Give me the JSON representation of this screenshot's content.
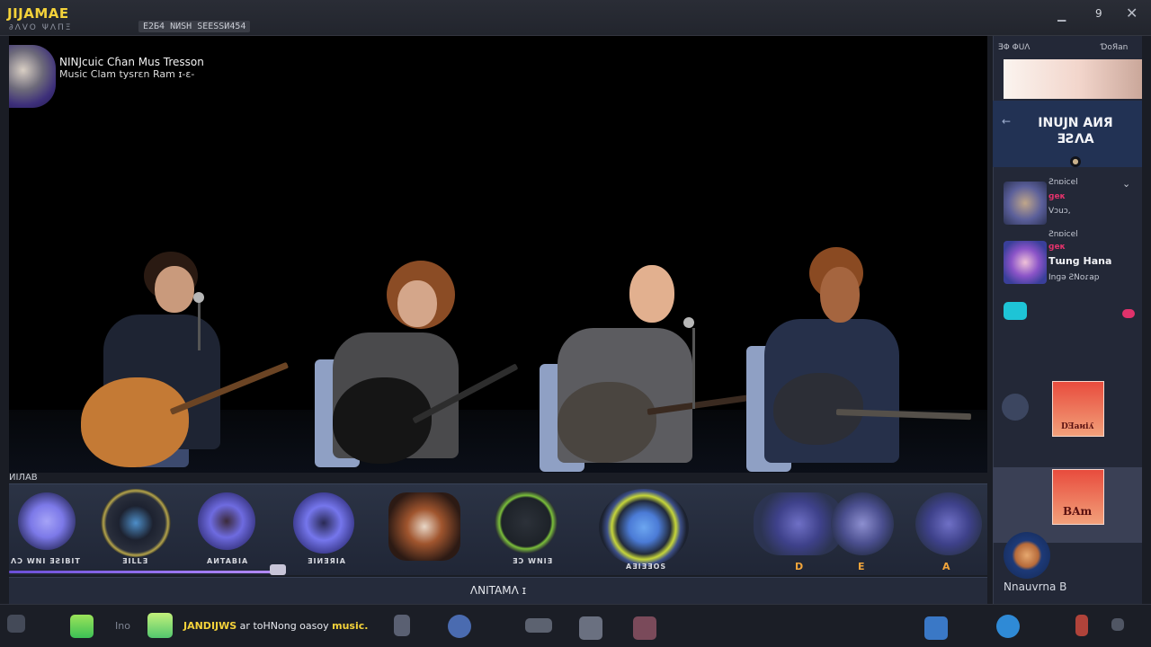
{
  "titlebar": {
    "app_name": "JIJAMAE",
    "app_sub": "∂ΛVO  ΨΛΠΞ",
    "session_label": "E2Б4 NИSH SEESSИ454",
    "window_count": "9",
    "minimize_icon": "minimize-icon",
    "close_icon": "close-icon"
  },
  "stage": {
    "channel_title": "NINJcuic Cɦan Mus Tresson",
    "channel_sub": "Music Clam tysrɛn Ram ɪ-ɛ-",
    "corner_label": "ИIЛAB",
    "colors": {
      "background": "#000000",
      "chair": "#3c4a6e"
    }
  },
  "mixer": {
    "knobs": [
      {
        "label": "ΛƆ WNI ƎƧIBIT",
        "color": "#7c79e8"
      },
      {
        "label": "ƎILLƎ",
        "color": "#2a2f3c"
      },
      {
        "label": "AИTABIA",
        "color": "#6e6be0"
      },
      {
        "label": "ƎIИƎЯIA",
        "color": "#7576ec"
      },
      {
        "label": "",
        "color": "#8a4e2c"
      },
      {
        "label": "ƎƆ WNIƎ",
        "color": "#2c3139"
      },
      {
        "label": "AƎIƎƎOS",
        "color": "#4b7bd6"
      }
    ],
    "vu_letters": [
      "D",
      "E",
      "A"
    ],
    "progress_percent": 27
  },
  "now_bar": {
    "label": "ΛNITAMΛ ɪ"
  },
  "sidebar": {
    "header_left": "ƎΦ ΦUΛ",
    "header_right": "ƊoЯan",
    "card_title": "INUJN AИЯ ƎƧΛA",
    "back_icon": "arrow-left-icon",
    "rows": [
      {
        "small_top": "Ƨnɒicel",
        "flag": "ɡeκ",
        "name": "",
        "small_bottom": "Vɔuɔ,"
      },
      {
        "small_top": "Ƨnɒicel",
        "flag": "ɡeκ",
        "name": "Tɯnɡ Hana",
        "small_bottom": "Inɡə ƧNoɾap"
      }
    ],
    "album_1_text": "DƎaᴎiʎ",
    "album_2_text": "BAm",
    "bottom_name": "Nnauvrna B"
  },
  "taskbar": {
    "ino_text": "Ino",
    "message_prefix": "JANDIJWS",
    "message_rest": " ar toHNong oasoy ",
    "message_highlight": "music."
  }
}
